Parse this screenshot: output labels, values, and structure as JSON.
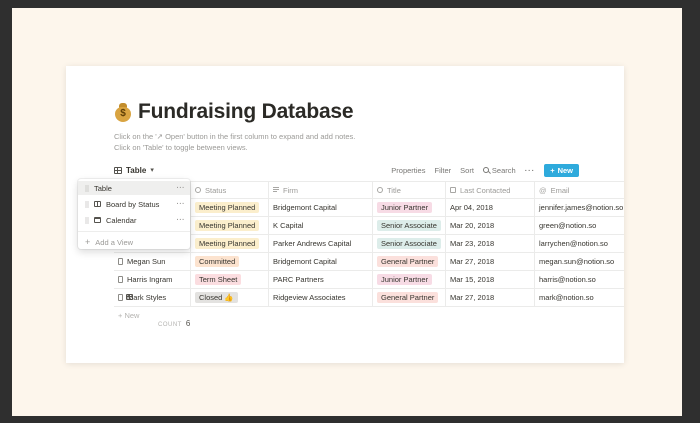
{
  "page": {
    "title": "Fundraising Database",
    "icon": "money-bag-icon",
    "description_line1": "Click on the '↗ Open' button in the first column to expand and add notes.",
    "description_line2": "Click on 'Table' to toggle between views."
  },
  "toolbar": {
    "view_label": "Table",
    "properties": "Properties",
    "filter": "Filter",
    "sort": "Sort",
    "search": "Search",
    "more": "···",
    "new_label": "New",
    "new_color": "#2eaadc"
  },
  "table": {
    "columns": {
      "status": "Status",
      "firm": "Firm",
      "title": "Title",
      "last_contacted": "Last Contacted",
      "email": "Email"
    },
    "rows": [
      {
        "name": "",
        "status": "Meeting Planned",
        "firm": "Bridgemont Capital",
        "title": "Junior Partner",
        "date": "Apr 04, 2018",
        "email": "jennifer.james@notion.so"
      },
      {
        "name": "",
        "status": "Meeting Planned",
        "firm": "K Capital",
        "title": "Senior Associate",
        "date": "Mar 20, 2018",
        "email": "green@notion.so"
      },
      {
        "name": "",
        "status": "Meeting Planned",
        "firm": "Parker Andrews Capital",
        "title": "Senior Associate",
        "date": "Mar 23, 2018",
        "email": "larrychen@notion.so"
      },
      {
        "name": "Megan Sun",
        "status": "Committed",
        "firm": "Bridgemont Capital",
        "title": "General Partner",
        "date": "Mar 27, 2018",
        "email": "megan.sun@notion.so"
      },
      {
        "name": "Harris Ingram",
        "status": "Term Sheet",
        "firm": "PARC Partners",
        "title": "Junior Partner",
        "date": "Mar 15, 2018",
        "email": "harris@notion.so"
      },
      {
        "name": "Mark Styles",
        "status": "Closed 👍",
        "firm": "Ridgeview Associates",
        "title": "General Partner",
        "date": "Mar 27, 2018",
        "email": "mark@notion.so"
      }
    ],
    "new_row_label": "+ New",
    "count_label": "COUNT",
    "count_value": "6"
  },
  "views_menu": {
    "items": [
      {
        "label": "Table",
        "icon": "table-icon"
      },
      {
        "label": "Board by Status",
        "icon": "board-icon"
      },
      {
        "label": "Calendar",
        "icon": "calendar-icon"
      }
    ],
    "more": "···",
    "add_label": "Add a View"
  }
}
